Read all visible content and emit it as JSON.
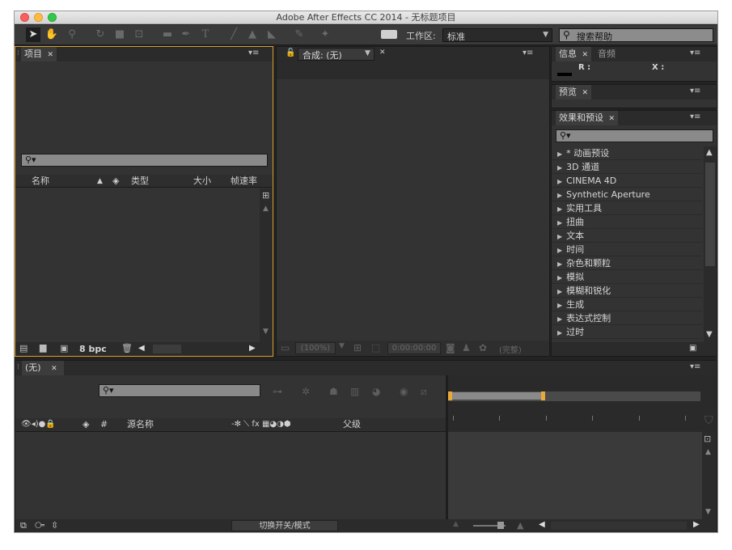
{
  "app": {
    "window_title": "Adobe After Effects CC 2014 - 无标题项目"
  },
  "toolbar": {
    "workspace_label": "工作区:",
    "workspace_value": "标准",
    "help_search_placeholder": "搜索帮助"
  },
  "project_panel": {
    "tab_label": "项目",
    "columns": {
      "name": "名称",
      "type": "类型",
      "size": "大小",
      "framerate": "帧速率"
    },
    "bpc": "8 bpc"
  },
  "composition_panel": {
    "tab_label": "合成: (无)",
    "zoom": "(100%)",
    "timecode": "0:00:00:00",
    "quality": "(完整)"
  },
  "info_panel": {
    "tab_info": "信息",
    "tab_audio": "音频",
    "r_label": "R :",
    "x_label": "X :"
  },
  "preview_panel": {
    "tab_label": "预览"
  },
  "effects_panel": {
    "tab_label": "效果和预设",
    "items": [
      "* 动画预设",
      "3D 通道",
      "CINEMA 4D",
      "Synthetic Aperture",
      "实用工具",
      "扭曲",
      "文本",
      "时间",
      "杂色和颗粒",
      "模拟",
      "模糊和锐化",
      "生成",
      "表达式控制",
      "过时"
    ]
  },
  "timeline_panel": {
    "tab_label": "(无)",
    "col_hash": "#",
    "col_source_name": "源名称",
    "col_parent": "父级",
    "toggle_modes": "切换开关/模式"
  },
  "colors": {
    "accent": "#e8a93b",
    "panel_bg": "#333333",
    "window_bg": "#232323"
  }
}
